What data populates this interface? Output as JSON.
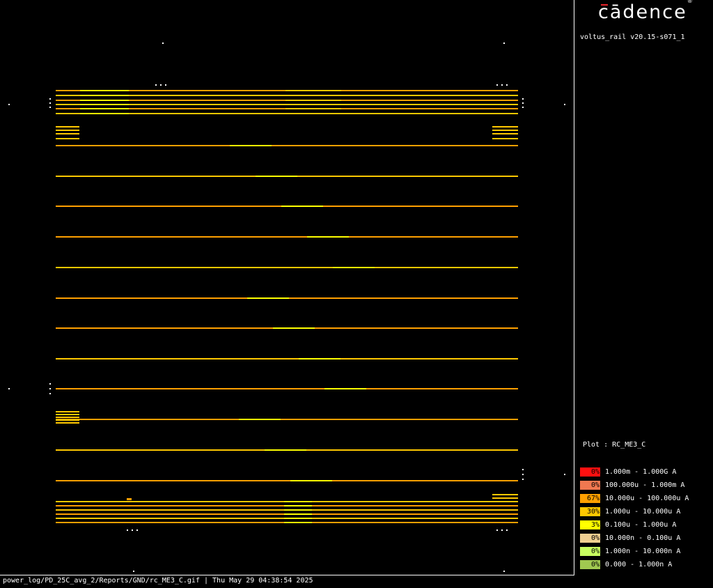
{
  "brand": {
    "name": "cādence",
    "mark": "®"
  },
  "version": "voltus_rail v20.15-s071_1",
  "plot": {
    "label": "Plot : RC_ME3_C"
  },
  "legend": [
    {
      "pct": "0%",
      "range": "1.000m - 1.000G A",
      "color": "#ff1010"
    },
    {
      "pct": "0%",
      "range": "100.000u - 1.000m A",
      "color": "#f07850"
    },
    {
      "pct": "67%",
      "range": "10.000u - 100.000u A",
      "color": "#ffa000"
    },
    {
      "pct": "30%",
      "range": "1.000u - 10.000u A",
      "color": "#ffc800"
    },
    {
      "pct": "3%",
      "range": "0.100u - 1.000u A",
      "color": "#ffff00"
    },
    {
      "pct": "0%",
      "range": "10.000n - 0.100u A",
      "color": "#f0d090"
    },
    {
      "pct": "0%",
      "range": "1.000n - 10.000n A",
      "color": "#c8ff60"
    },
    {
      "pct": "0%",
      "range": "0.000 - 1.000n A",
      "color": "#a0c850"
    }
  ],
  "footer": "power_log/PD_25C_avg_2/Reports/GND/rc_ME3_C.gif | Thu May 29 04:38:54 2025"
}
